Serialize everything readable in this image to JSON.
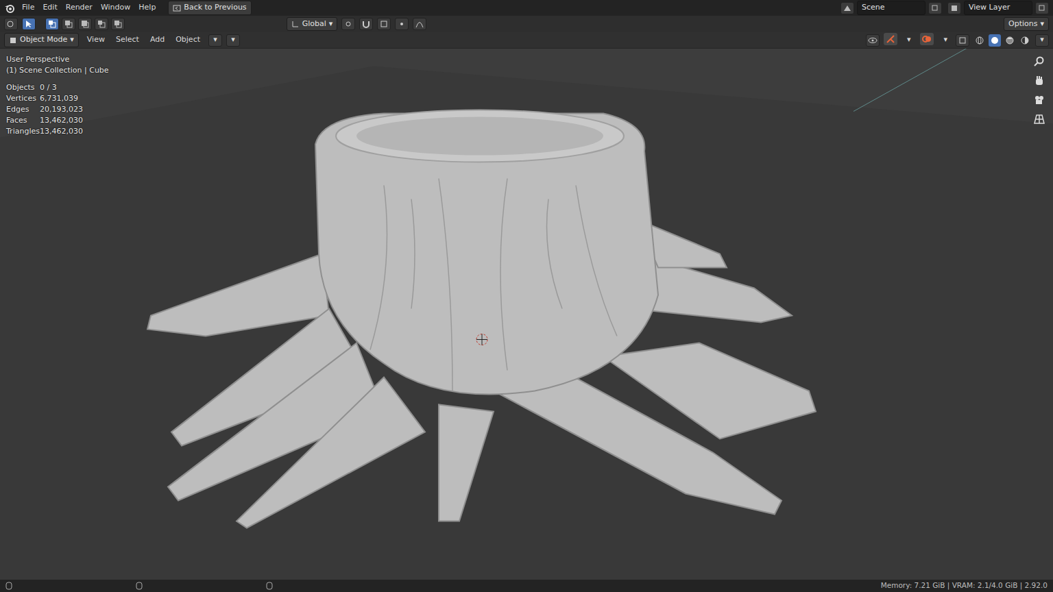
{
  "menu": [
    "File",
    "Edit",
    "Render",
    "Window",
    "Help"
  ],
  "back_button": "Back to Previous",
  "scene": "Scene",
  "view_layer": "View Layer",
  "select_modes": [
    {
      "selected": true
    },
    {
      "selected": false
    },
    {
      "selected": false
    },
    {
      "selected": false
    },
    {
      "selected": false
    }
  ],
  "toolbar": {
    "orientation": "Global",
    "options": "Options"
  },
  "header": {
    "mode": "Object Mode",
    "menus": [
      "View",
      "Select",
      "Add",
      "Object"
    ]
  },
  "viewport_toggles": [
    {
      "kind": "gizmo",
      "on": true
    },
    {
      "kind": "overlay",
      "on": true
    }
  ],
  "viewport_shading": [
    {
      "kind": "wireframe",
      "selected": false
    },
    {
      "kind": "solid",
      "selected": true
    },
    {
      "kind": "material",
      "selected": false
    },
    {
      "kind": "rendered",
      "selected": false
    }
  ],
  "overlay": {
    "view": "User Perspective",
    "collection": "(1) Scene Collection | Cube",
    "stats": [
      {
        "label": "Objects",
        "value": "0 / 3"
      },
      {
        "label": "Vertices",
        "value": "6,731,039"
      },
      {
        "label": "Edges",
        "value": "20,193,023"
      },
      {
        "label": "Faces",
        "value": "13,462,030"
      },
      {
        "label": "Triangles",
        "value": "13,462,030"
      }
    ]
  },
  "status_bar": "Memory: 7.21 GiB | VRAM: 2.1/4.0 GiB | 2.92.0"
}
